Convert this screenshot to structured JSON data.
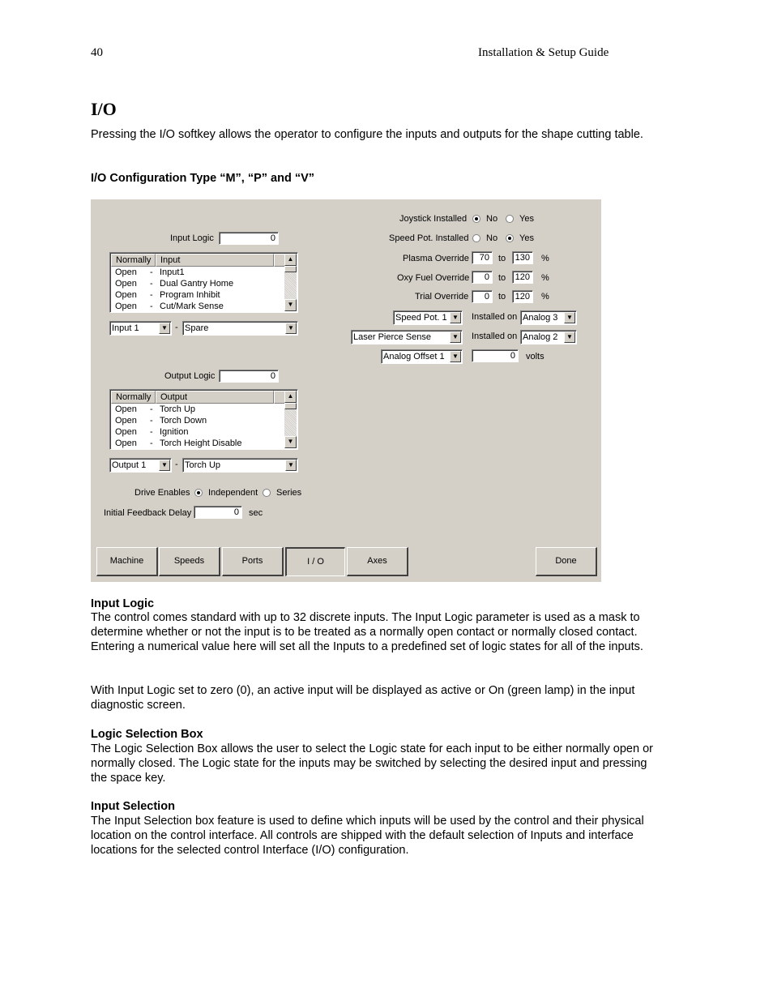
{
  "header": {
    "page_number": "40",
    "doc_title": "Installation & Setup Guide"
  },
  "section_title": "I/O",
  "intro": "Pressing the I/O softkey allows the operator to configure the inputs and outputs for the shape cutting table.",
  "subheading": "I/O Configuration Type “M”, “P” and “V”",
  "dialog": {
    "input_logic": {
      "label": "Input Logic",
      "value": "0"
    },
    "input_list": {
      "headers": [
        "Normally",
        "Input"
      ],
      "rows": [
        {
          "state": "Open",
          "name": "Input1"
        },
        {
          "state": "Open",
          "name": "Dual Gantry Home"
        },
        {
          "state": "Open",
          "name": "Program Inhibit"
        },
        {
          "state": "Open",
          "name": "Cut/Mark Sense"
        }
      ]
    },
    "input_select": {
      "number": "Input 1",
      "sep": "-",
      "function": "Spare"
    },
    "output_logic": {
      "label": "Output Logic",
      "value": "0"
    },
    "output_list": {
      "headers": [
        "Normally",
        "Output"
      ],
      "rows": [
        {
          "state": "Open",
          "name": "Torch Up"
        },
        {
          "state": "Open",
          "name": "Torch Down"
        },
        {
          "state": "Open",
          "name": "Ignition"
        },
        {
          "state": "Open",
          "name": "Torch Height Disable"
        }
      ]
    },
    "output_select": {
      "number": "Output 1",
      "sep": "-",
      "function": "Torch Up"
    },
    "drive_enables": {
      "label": "Drive Enables",
      "options": [
        "Independent",
        "Series"
      ],
      "selected": "Independent"
    },
    "feedback_delay": {
      "label": "Initial Feedback Delay",
      "value": "0",
      "unit": "sec"
    },
    "joystick": {
      "label": "Joystick Installed",
      "options": [
        "No",
        "Yes"
      ],
      "selected": "No"
    },
    "speed_pot": {
      "label": "Speed Pot. Installed",
      "options": [
        "No",
        "Yes"
      ],
      "selected": "Yes"
    },
    "overrides": [
      {
        "label": "Plasma Override",
        "min": "70",
        "to": "to",
        "max": "130",
        "unit": "%"
      },
      {
        "label": "Oxy Fuel Override",
        "min": "0",
        "to": "to",
        "max": "120",
        "unit": "%"
      },
      {
        "label": "Trial Override",
        "min": "0",
        "to": "to",
        "max": "120",
        "unit": "%"
      }
    ],
    "analog1": {
      "device": "Speed Pot. 1",
      "label": "Installed on",
      "port": "Analog 3"
    },
    "analog2": {
      "device": "Laser Pierce Sense",
      "label": "Installed on",
      "port": "Analog 2"
    },
    "offset": {
      "select": "Analog Offset 1",
      "value": "0",
      "unit": "volts"
    },
    "softkeys": [
      "Machine",
      "Speeds",
      "Ports",
      "I / O",
      "Axes"
    ],
    "active_softkey": "I / O",
    "done": "Done"
  },
  "sections": [
    {
      "title": "Input Logic",
      "paragraphs": [
        "The control comes standard with up to 32 discrete inputs.  The Input Logic parameter is used as a mask to determine whether or not the input is to be treated as a normally open contact or normally closed contact.  Entering a numerical value here will set all the Inputs to a predefined set of logic states for all of the inputs.",
        "With Input Logic set to zero (0), an active input will be displayed as active or On (green lamp) in the input diagnostic screen."
      ]
    },
    {
      "title": "Logic Selection Box",
      "paragraphs": [
        "The Logic Selection Box allows the user to select the Logic state for each input to be either normally open or normally closed. The Logic state for the inputs may be switched by selecting the desired input and pressing the space key."
      ]
    },
    {
      "title": "Input Selection",
      "paragraphs": [
        "The Input Selection box feature is used to define which inputs will be used by the control and their physical location on the control interface.  All controls are shipped with the default selection of Inputs and interface locations for the selected control Interface (I/O) configuration."
      ]
    }
  ]
}
